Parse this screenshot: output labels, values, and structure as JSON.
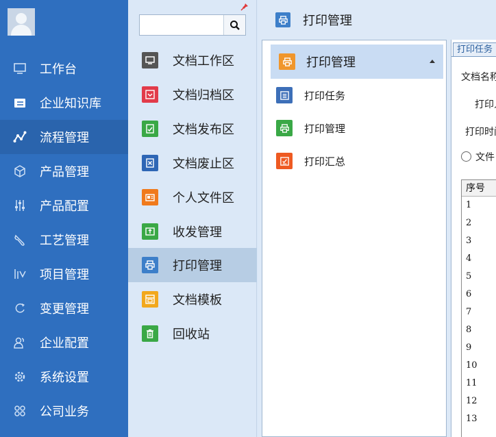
{
  "nav": {
    "items": [
      {
        "label": "工作台",
        "icon": "monitor-icon"
      },
      {
        "label": "企业知识库",
        "icon": "folder-icon"
      },
      {
        "label": "流程管理",
        "icon": "flow-icon"
      },
      {
        "label": "产品管理",
        "icon": "cube-icon"
      },
      {
        "label": "产品配置",
        "icon": "sliders-icon"
      },
      {
        "label": "工艺管理",
        "icon": "wrench-icon"
      },
      {
        "label": "项目管理",
        "icon": "chart-icon"
      },
      {
        "label": "变更管理",
        "icon": "cycle-icon"
      },
      {
        "label": "企业配置",
        "icon": "users-icon"
      },
      {
        "label": "系统设置",
        "icon": "gear-icon"
      },
      {
        "label": "公司业务",
        "icon": "grid-icon"
      }
    ]
  },
  "search": {
    "value": "",
    "placeholder": ""
  },
  "subnav": {
    "items": [
      {
        "label": "文档工作区",
        "icon": "monitor-icon",
        "color": "#555555"
      },
      {
        "label": "文档归档区",
        "icon": "archive-icon",
        "color": "#e23b4a"
      },
      {
        "label": "文档发布区",
        "icon": "publish-icon",
        "color": "#3aa846"
      },
      {
        "label": "文档废止区",
        "icon": "cancel-icon",
        "color": "#2e66b5"
      },
      {
        "label": "个人文件区",
        "icon": "id-card-icon",
        "color": "#f07a1c"
      },
      {
        "label": "收发管理",
        "icon": "transfer-icon",
        "color": "#3aa846"
      },
      {
        "label": "打印管理",
        "icon": "printer-icon",
        "color": "#3d7fc9"
      },
      {
        "label": "文档模板",
        "icon": "template-icon",
        "color": "#f2a81d"
      },
      {
        "label": "回收站",
        "icon": "trash-icon",
        "color": "#3aa846"
      }
    ]
  },
  "main": {
    "title": "打印管理",
    "tree": {
      "header": "打印管理",
      "items": [
        {
          "label": "打印任务",
          "icon": "list-icon",
          "color": "#3d6fb8"
        },
        {
          "label": "打印管理",
          "icon": "printer-icon",
          "color": "#3aa846"
        },
        {
          "label": "打印汇总",
          "icon": "summary-icon",
          "color": "#ee5a22"
        }
      ]
    },
    "panel": {
      "tab": "打印任务",
      "labels": [
        "文档名称",
        "打印人",
        "打印时间"
      ],
      "radio_label": "文件",
      "grid_header": "序号",
      "rows": [
        "1",
        "2",
        "3",
        "4",
        "5",
        "6",
        "7",
        "8",
        "9",
        "10",
        "11",
        "12",
        "13"
      ]
    }
  }
}
